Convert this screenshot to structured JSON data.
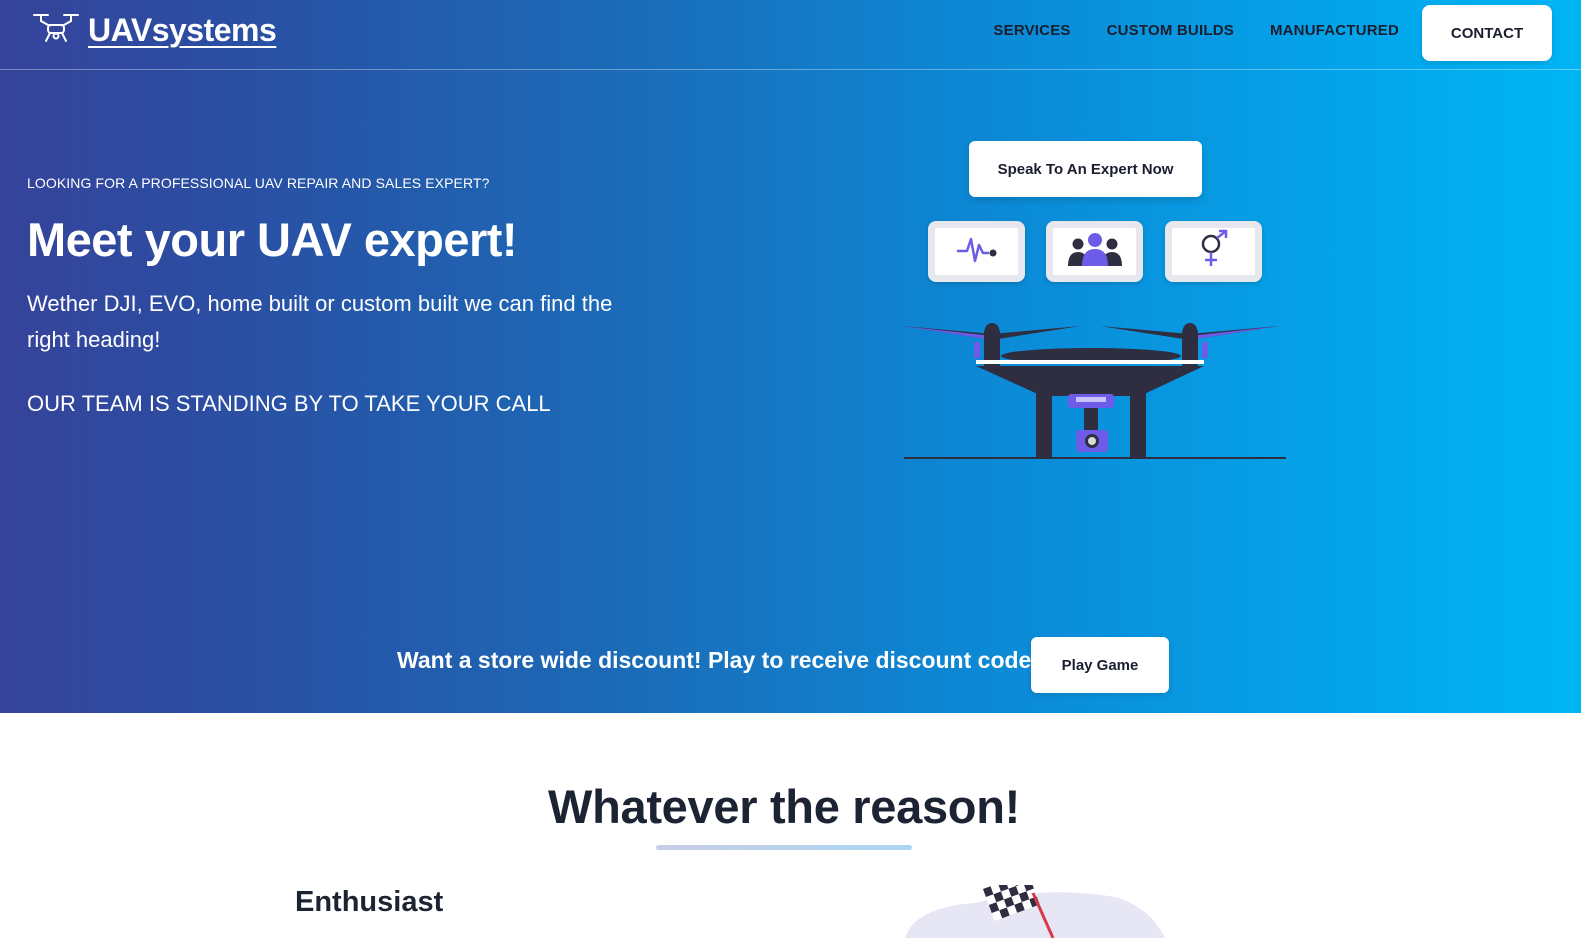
{
  "nav": {
    "brand": "UAVsystems",
    "links": [
      "SERVICES",
      "CUSTOM BUILDS",
      "MANUFACTURED"
    ],
    "contact_label": "CONTACT"
  },
  "hero": {
    "eyebrow": "LOOKING FOR A PROFESSIONAL UAV REPAIR AND SALES EXPERT?",
    "headline": "Meet your UAV expert!",
    "subtext": "Wether DJI, EVO, home built or custom built we can find the right heading!",
    "team_line": "OUR TEAM IS STANDING BY TO TAKE YOUR CALL",
    "expert_button": "Speak To An Expert Now",
    "monitor_icons": [
      "heartbeat-icon",
      "team-icon",
      "gender-icon"
    ]
  },
  "promo": {
    "text": "Want a store wide discount! Play to receive discount code!",
    "button": "Play Game"
  },
  "reasons": {
    "title": "Whatever the reason!",
    "card_title": "Enthusiast"
  },
  "colors": {
    "gradient_start": "#35439a",
    "gradient_end": "#00b5f4",
    "accent_purple": "#6c5ce7",
    "dark_text": "#1c2434",
    "drone_body": "#2f2e41"
  }
}
